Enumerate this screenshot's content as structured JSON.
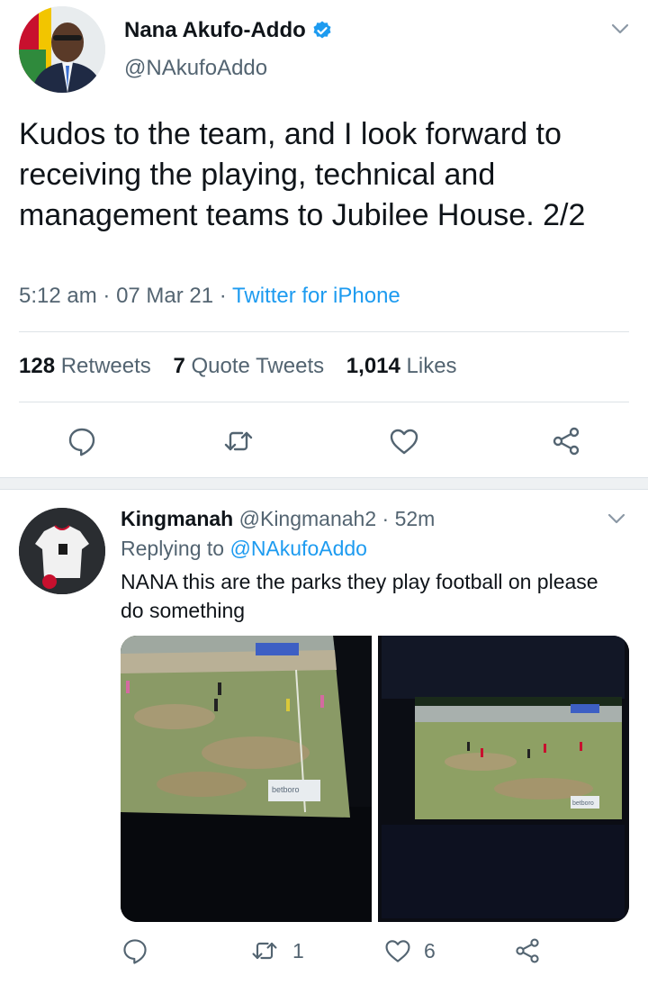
{
  "main_tweet": {
    "author_name": "Nana Akufo-Addo",
    "author_handle": "@NAkufoAddo",
    "text": "Kudos to the team, and I look forward to receiving the playing, technical and management teams to Jubilee House. 2/2",
    "time": "5:12 am",
    "date": "07 Mar 21",
    "source": "Twitter for iPhone",
    "retweets_count": "128",
    "retweets_label": "Retweets",
    "quotes_count": "7",
    "quotes_label": "Quote Tweets",
    "likes_count": "1,014",
    "likes_label": "Likes",
    "icons": [
      "reply-icon",
      "retweet-icon",
      "like-icon",
      "share-icon",
      "verified-badge-icon",
      "chevron-down-icon"
    ]
  },
  "reply": {
    "author_name": "Kingmanah",
    "author_handle": "@Kingmanah2",
    "separator": "·",
    "age": "52m",
    "replying_to_label": "Replying to",
    "replying_to_handle": "@NAkufoAddo",
    "text": "NANA this are the parks they play football on please do something",
    "retweets_count": "1",
    "likes_count": "6",
    "media_overlay_texts": [
      "betboro",
      "betboro"
    ]
  },
  "colors": {
    "text": "#0f1419",
    "secondary": "#536471",
    "accent": "#1d9bf0",
    "divider": "#dde3e7"
  }
}
